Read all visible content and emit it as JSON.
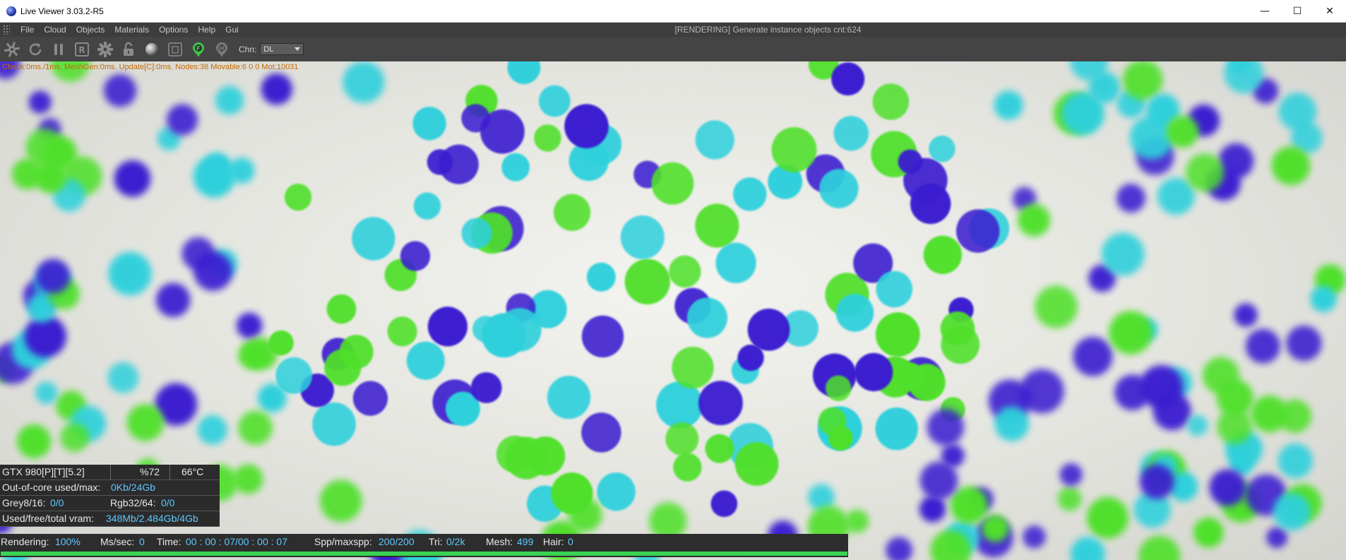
{
  "window": {
    "title": "Live Viewer 3.03.2-R5",
    "controls": {
      "minimize": "—",
      "maximize": "☐",
      "close": "✕"
    }
  },
  "menu": {
    "items": [
      "File",
      "Cloud",
      "Objects",
      "Materials",
      "Options",
      "Help",
      "Gui"
    ],
    "status": "[RENDERING] Generate instance objects cnt:624"
  },
  "toolbar": {
    "buttons": [
      "gear-icon",
      "reload-icon",
      "pause-icon",
      "region-render-icon",
      "settings-icon",
      "lock-icon",
      "material-ball-icon",
      "clay-mode-icon",
      "focus-pick-icon",
      "material-pick-icon"
    ],
    "channel_label": "Chn:",
    "channel_value": "DL"
  },
  "stats": {
    "line": "Check:0ms./1ms. MeshGen:0ms. Update[C]:0ms. Nodes:38 Movable:6  0 0 Mot:10031"
  },
  "gpu": {
    "name": "GTX 980[P][T][5.2]",
    "load": "%72",
    "temp": "66°C",
    "out_of_core_label": "Out-of-core used/max:",
    "out_of_core_value": "0Kb/24Gb",
    "grey_label": "Grey8/16:",
    "grey_value": "0/0",
    "rgb_label": "Rgb32/64:",
    "rgb_value": "0/0",
    "vram_label": "Used/free/total vram:",
    "vram_value": "348Mb/2.484Gb/4Gb"
  },
  "status": {
    "rendering_label": "Rendering:",
    "rendering_value": "100%",
    "mssec_label": "Ms/sec:",
    "mssec_value": "0",
    "time_label": "Time:",
    "time_value": "00 : 00 : 07/00 : 00 : 07",
    "spp_label": "Spp/maxspp:",
    "spp_value": "200/200",
    "tri_label": "Tri:",
    "tri_value": "0/2k",
    "mesh_label": "Mesh:",
    "mesh_value": "499",
    "hair_label": "Hair:",
    "hair_value": "0",
    "progress": 1.0
  },
  "colors": {
    "sphere_blue": "#3a1fd0",
    "sphere_cyan": "#2fd0dc",
    "sphere_green": "#4fe02a",
    "progress": "#39d353",
    "value_text": "#5fc9ff",
    "stats_text": "#c46a00"
  }
}
